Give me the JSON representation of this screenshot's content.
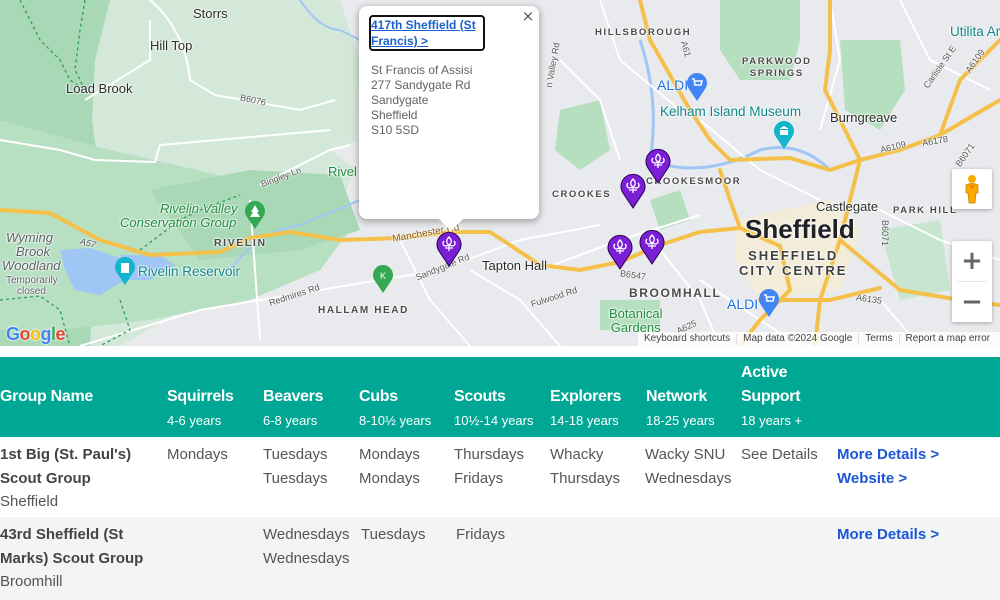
{
  "map": {
    "labels": {
      "storrs": "Storrs",
      "hill_top": "Hill Top",
      "load_brook": "Load Brook",
      "b6076": "B6076",
      "bingley_ln": "Bingley Ln",
      "rivelin_top": "Rivel",
      "rivelin_valley_1": "Rivelin Valley",
      "rivelin_valley_2": "Conservation Group",
      "rivelin": "RIVELIN",
      "wyming_1": "Wyming",
      "wyming_2": "Brook",
      "wyming_3": "Woodland",
      "temp_1": "Temporarily",
      "temp_2": "closed",
      "a57": "A57",
      "rivelin_reservoir": "Rivelin Reservoir",
      "redmires_rd": "Redmires Rd",
      "hallam_head": "HALLAM HEAD",
      "manchester_rd": "Manchester Rd",
      "sandygate_rd": "Sandygate Rd",
      "tapton_hall": "Tapton Hall",
      "fulwood_rd": "Fulwood Rd",
      "hillsborough": "HILLSBOROUGH",
      "a61": "A61",
      "aldi_north": "ALDI",
      "kelham": "Kelham Island Museum",
      "parkwood_1": "PARKWOOD",
      "parkwood_2": "SPRINGS",
      "burngreave": "Burngreave",
      "utilita": "Utilita Ar",
      "carlisle": "Carlisle St E",
      "a6109": "A6109",
      "a6178": "A6178",
      "b6071": "B6071",
      "crookes": "CROOKES",
      "crookesmoor": "CROOKESMOOR",
      "castlegate": "Castlegate",
      "park_hill": "PARK HILL",
      "sheffield": "Sheffield",
      "city_1": "SHEFFIELD",
      "city_2": "CITY CENTRE",
      "broomhall": "BROOMHALL",
      "b6547": "B6547",
      "aldi_south": "ALDI",
      "a6135": "A6135",
      "botanical_1": "Botanical",
      "botanical_2": "Gardens",
      "valley_rd": "n Valley Rd",
      "a625": "A625"
    },
    "info_window": {
      "title": "417th Sheffield (St Francis) >",
      "address_lines": [
        "St Francis of Assisi",
        "277 Sandygate Rd",
        "Sandygate",
        "Sheffield",
        "S10 5SD"
      ],
      "close_label": "×"
    },
    "controls": {
      "zoom_in": "+",
      "zoom_out": "−"
    },
    "attribution": {
      "keyboard": "Keyboard shortcuts",
      "map_data": "Map data ©2024 Google",
      "terms": "Terms",
      "report": "Report a map error"
    },
    "google_logo": [
      "G",
      "o",
      "o",
      "g",
      "l",
      "e"
    ],
    "marker_color": "#7b1fd6"
  },
  "table": {
    "header_color": "#00a794",
    "link_color": "#1a56d6",
    "columns": [
      {
        "title": "Group Name",
        "age": ""
      },
      {
        "title": "Squirrels",
        "age": "4-6 years"
      },
      {
        "title": "Beavers",
        "age": "6-8 years"
      },
      {
        "title": "Cubs",
        "age": "8-10½ years"
      },
      {
        "title": "Scouts",
        "age": "10½-14 years"
      },
      {
        "title": "Explorers",
        "age": "14-18 years"
      },
      {
        "title": "Network",
        "age": "18-25 years"
      },
      {
        "title_line1": "Active",
        "title_line2": "Support",
        "age": "18 years +"
      }
    ],
    "rows": [
      {
        "name": "1st Big (St. Paul's) Scout Group",
        "area": "Sheffield",
        "squirrels": "Mondays",
        "beavers": [
          "Tuesdays",
          "Tuesdays"
        ],
        "cubs": [
          "Mondays",
          "Mondays"
        ],
        "scouts": [
          "Thursdays",
          "Fridays"
        ],
        "explorers": [
          "Whacky",
          "Thursdays"
        ],
        "network": [
          "Wacky SNU",
          "Wednesdays"
        ],
        "active_support": "See Details",
        "links": [
          "More Details >",
          "Website >"
        ]
      },
      {
        "name": "43rd Sheffield (St Marks) Scout Group",
        "area": "Broomhill",
        "squirrels": "",
        "beavers": [
          "Wednesdays",
          "Wednesdays"
        ],
        "cubs": [
          "Tuesdays"
        ],
        "scouts": [
          "Fridays"
        ],
        "explorers": [],
        "network": [],
        "active_support": "",
        "links": [
          "More Details >"
        ]
      }
    ]
  }
}
